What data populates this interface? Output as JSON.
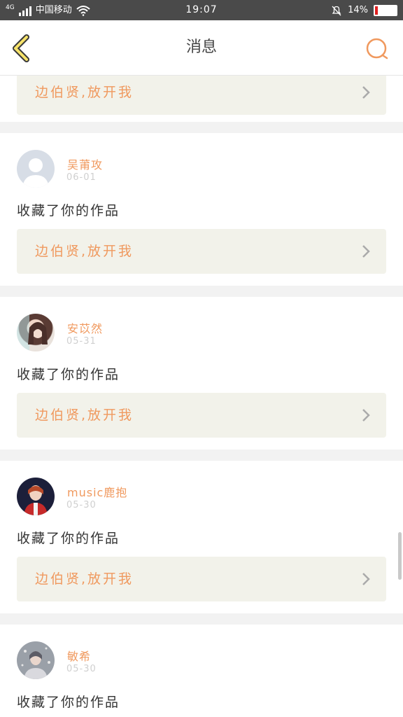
{
  "status_bar": {
    "network": "4G",
    "carrier": "中国移动",
    "time": "19:07",
    "battery": "14%",
    "battery_level": 0.14,
    "battery_color": "#e02020"
  },
  "header": {
    "title": "消息",
    "back_icon": "chevron-left-icon",
    "search_icon": "search-icon",
    "accent_color": "#f0995e"
  },
  "first_card_partial": {
    "work_title": "边伯贤,放开我"
  },
  "notifications": [
    {
      "username": "吴莆攻",
      "date": "06-01",
      "action": "收藏了你的作品",
      "work_title": "边伯贤,放开我",
      "avatar": "default-avatar"
    },
    {
      "username": "安苡然",
      "date": "05-31",
      "action": "收藏了你的作品",
      "work_title": "边伯贤,放开我",
      "avatar": "photo-avatar"
    },
    {
      "username": "music鹿抱",
      "date": "05-30",
      "action": "收藏了你的作品",
      "work_title": "边伯贤,放开我",
      "avatar": "photo-avatar"
    },
    {
      "username": "敏希",
      "date": "05-30",
      "action": "收藏了你的作品",
      "work_title": "",
      "avatar": "photo-avatar"
    }
  ]
}
